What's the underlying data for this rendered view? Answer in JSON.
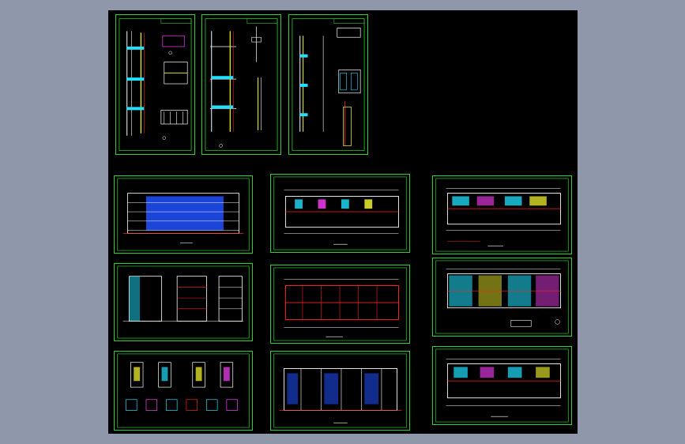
{
  "viewport": {
    "background": "#8e98aa",
    "model_space": "#000000",
    "frame_color": "#28d228",
    "line_colors": [
      "#ffffff",
      "#ff2020",
      "#20e0ff",
      "#ffff30",
      "#28d228",
      "#2050ff",
      "#ff40ff"
    ]
  },
  "sheets": [
    {
      "id": "detail-1",
      "kind": "wall-detail",
      "title": ""
    },
    {
      "id": "detail-2",
      "kind": "wall-detail",
      "title": ""
    },
    {
      "id": "detail-3",
      "kind": "wall-detail",
      "title": ""
    },
    {
      "id": "elevation-front",
      "kind": "elevation",
      "title": ""
    },
    {
      "id": "floor-plan-1",
      "kind": "floor-plan",
      "title": ""
    },
    {
      "id": "floor-plan-2",
      "kind": "floor-plan",
      "title": ""
    },
    {
      "id": "section-views",
      "kind": "sections",
      "title": ""
    },
    {
      "id": "floor-plan-3",
      "kind": "floor-plan",
      "title": ""
    },
    {
      "id": "floor-plan-4",
      "kind": "floor-plan",
      "title": ""
    },
    {
      "id": "stair-details",
      "kind": "details",
      "title": ""
    },
    {
      "id": "elevation-rear",
      "kind": "elevation",
      "title": ""
    },
    {
      "id": "floor-plan-5",
      "kind": "floor-plan",
      "title": ""
    }
  ]
}
